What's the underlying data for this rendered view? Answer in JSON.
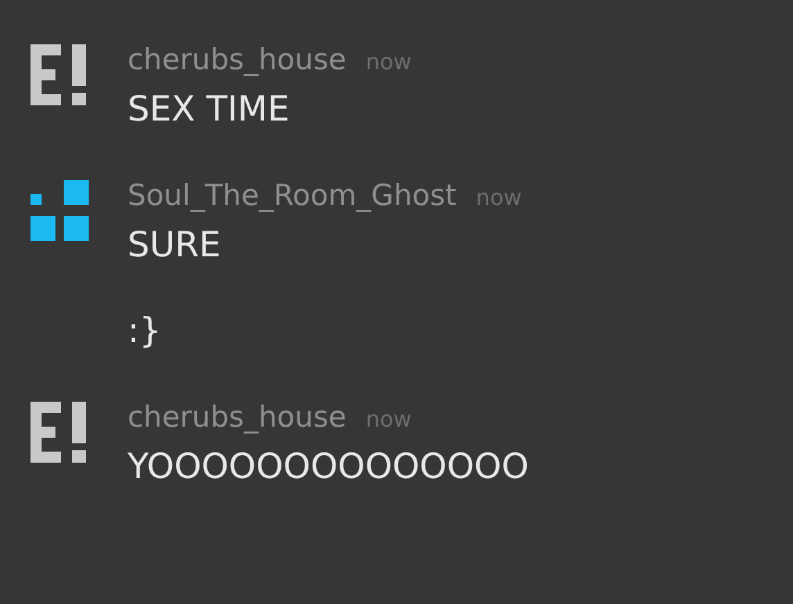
{
  "messages": [
    {
      "avatar": {
        "kind": "exclaim"
      },
      "author": "cherubs_house",
      "time": "now",
      "lines": [
        "SEX TIME"
      ]
    },
    {
      "avatar": {
        "kind": "squares"
      },
      "author": "Soul_The_Room_Ghost",
      "time": "now",
      "lines": [
        "SURE",
        ":}"
      ]
    },
    {
      "avatar": {
        "kind": "exclaim"
      },
      "author": "cherubs_house",
      "time": "now",
      "lines": [
        "YOOOOOOOOOOOOOO"
      ]
    }
  ]
}
